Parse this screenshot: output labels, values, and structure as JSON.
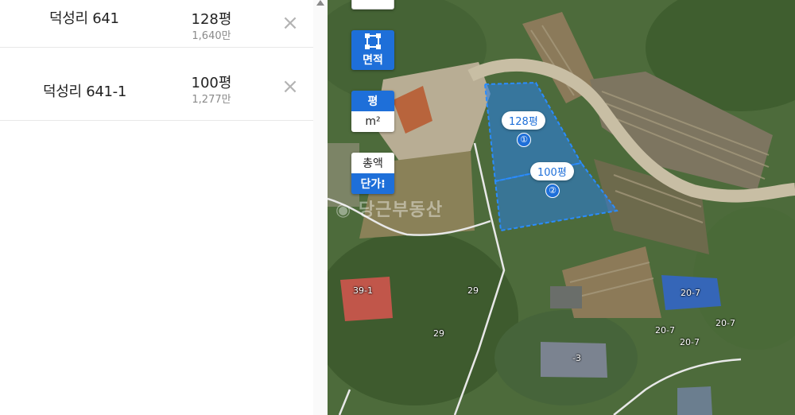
{
  "parcels": [
    {
      "name": "덕성리 641",
      "area": "128평",
      "price": "1,640만"
    },
    {
      "name": "덕성리 641-1",
      "area": "100평",
      "price": "1,277만"
    }
  ],
  "delete_glyph": "×",
  "controls": {
    "area_button_label": "면적",
    "unit_options": [
      "평",
      "m²"
    ],
    "price_options": [
      "총액",
      "단가⁝"
    ]
  },
  "map_labels": {
    "parcel_1_area": "128평",
    "parcel_1_number": "①",
    "parcel_2_area": "100평",
    "parcel_2_number": "②",
    "watermark": "당근부동산",
    "lots": [
      "39-1",
      "29",
      "29",
      "20-7",
      "20-7",
      "20-7",
      "20-7",
      "-3"
    ]
  },
  "colors": {
    "accent": "#1e6fd9",
    "selection_fill": "#2a7de0",
    "selection_border": "#2a8cff"
  },
  "icons": {
    "area_tool": "square-select-icon",
    "delete": "close-icon",
    "scroll_up": "triangle-up-icon",
    "watermark": "carrot-icon"
  }
}
